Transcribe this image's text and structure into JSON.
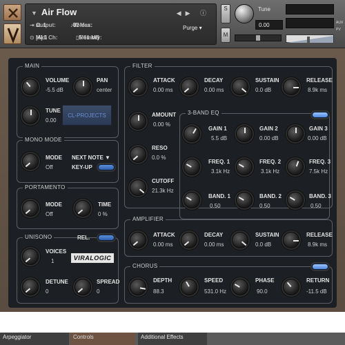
{
  "header": {
    "instrument_name": "Air Flow",
    "output_label": "Output:",
    "output_value": "st. 1",
    "voices_label": "Voices:",
    "voices_value": "0",
    "max_label": "Max:",
    "max_value": "32",
    "purge_label": "Purge",
    "midi_label": "Midi Ch:",
    "midi_value": "[A] 1",
    "memory_label": "Memory:",
    "memory_value": "5.61 MB",
    "s_label": "S",
    "m_label": "M",
    "tune_label": "Tune",
    "tune_value": "0.00",
    "aux_label": "AUX",
    "pv_label": "PV",
    "pan_marker": "L R"
  },
  "main": {
    "title": "MAIN",
    "volume_label": "VOLUME",
    "volume_value": "-5.5 dB",
    "pan_label": "PAN",
    "pan_value": "center",
    "tune_label": "TUNE",
    "tune_value": "0.00",
    "logo_text": "CL-PROJECTS"
  },
  "mono_mode": {
    "title": "MONO MODE",
    "mode_label": "MODE",
    "mode_value": "Off",
    "next_note_label": "NEXT NOTE ▼",
    "key_up_label": "KEY-UP"
  },
  "portamento": {
    "title": "PORTAMENTO",
    "mode_label": "MODE",
    "mode_value": "Off",
    "time_label": "TIME",
    "time_value": "0 %",
    "rel_label": "REL."
  },
  "unisono": {
    "title": "UNISONO",
    "voices_label": "VOICES",
    "voices_value": "1",
    "detune_label": "DETUNE",
    "detune_value": "0",
    "spread_label": "SPREAD",
    "spread_value": "0",
    "brand_logo": "VIRALOGIC"
  },
  "filter": {
    "title": "FILTER",
    "attack_label": "ATTACK",
    "attack_value": "0.00 ms",
    "decay_label": "DECAY",
    "decay_value": "0.00 ms",
    "sustain_label": "SUSTAIN",
    "sustain_value": "0.0 dB",
    "release_label": "RELEASE",
    "release_value": "8.9k ms",
    "amount_label": "AMOUNT",
    "amount_value": "0.00 %",
    "reso_label": "RESO",
    "reso_value": "0.0 %",
    "cutoff_label": "CUTOFF",
    "cutoff_value": "21.3k Hz"
  },
  "eq": {
    "title": "3-BAND EQ",
    "gain1_label": "GAIN 1",
    "gain1_value": "5.5 dB",
    "gain2_label": "GAIN 2",
    "gain2_value": "0.00 dB",
    "gain3_label": "GAIN 3",
    "gain3_value": "0.00 dB",
    "freq1_label": "FREQ. 1",
    "freq1_value": "3.1k Hz",
    "freq2_label": "FREQ. 2",
    "freq2_value": "3.1k Hz",
    "freq3_label": "FREQ. 3",
    "freq3_value": "7.5k Hz",
    "band1_label": "BAND. 1",
    "band1_value": "0.50",
    "band2_label": "BAND. 2",
    "band2_value": "0.50",
    "band3_label": "BAND. 3",
    "band3_value": "0.50"
  },
  "amplifier": {
    "title": "AMPLIFIER",
    "attack_label": "ATTACK",
    "attack_value": "0.00 ms",
    "decay_label": "DECAY",
    "decay_value": "0.00 ms",
    "sustain_label": "SUSTAIN",
    "sustain_value": "0.0 dB",
    "release_label": "RELEASE",
    "release_value": "8.9k ms"
  },
  "chorus": {
    "title": "CHORUS",
    "depth_label": "DEPTH",
    "depth_value": "88.3",
    "speed_label": "SPEED",
    "speed_value": "531.0 Hz",
    "phase_label": "PHASE",
    "phase_value": "90.0",
    "return_label": "RETURN",
    "return_value": "-11.5 dB"
  },
  "tabs": [
    "Arpeggiator",
    "Controls",
    "Additional Effects"
  ],
  "colors": {
    "toggle_blue": "#4d86db",
    "panel_brown": "#5a4c40",
    "inner_bg": "#1c1f24"
  }
}
